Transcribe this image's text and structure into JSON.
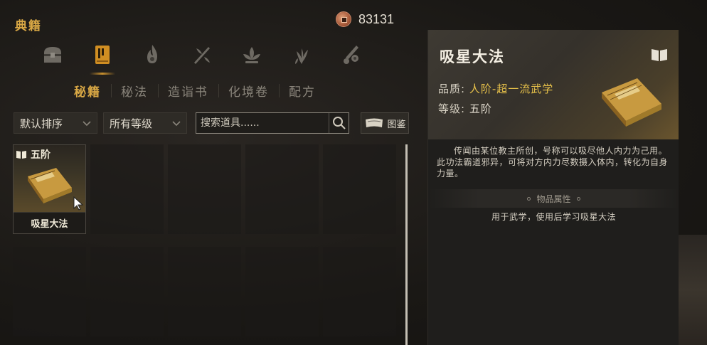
{
  "header": {
    "title": "典籍",
    "currency_value": "83131",
    "currency_icon": "copper-coin-icon"
  },
  "categories": [
    {
      "name": "chest-icon"
    },
    {
      "name": "scroll-book-icon",
      "active": true
    },
    {
      "name": "flame-icon"
    },
    {
      "name": "crossed-weapon-icon"
    },
    {
      "name": "lotus-icon"
    },
    {
      "name": "herb-icon"
    },
    {
      "name": "sword-gourd-icon"
    }
  ],
  "subtabs": [
    {
      "label": "秘籍",
      "active": true
    },
    {
      "label": "秘法"
    },
    {
      "label": "造诣书"
    },
    {
      "label": "化境卷"
    },
    {
      "label": "配方"
    }
  ],
  "filters": {
    "sort_label": "默认排序",
    "grade_label": "所有等级",
    "search_placeholder": "搜索道具......",
    "atlas_label": "图鉴"
  },
  "items": [
    {
      "tier": "五阶",
      "name": "吸星大法",
      "selected": true
    }
  ],
  "detail": {
    "title": "吸星大法",
    "quality_label": "品质:",
    "quality_value": "人阶-超一流武学",
    "grade_label": "等级:",
    "grade_value": "五阶",
    "description": "传闻由某位教主所创，号称可以吸尽他人内力为己用。此功法霸道邪异，可将对方内力尽数摄入体内，转化为自身力量。",
    "attr_header": "物品属性",
    "attr_text": "用于武学，使用后学习吸星大法"
  },
  "colors": {
    "accent": "#d9a845",
    "quality": "#e8c24a",
    "background": "#1a1815"
  }
}
